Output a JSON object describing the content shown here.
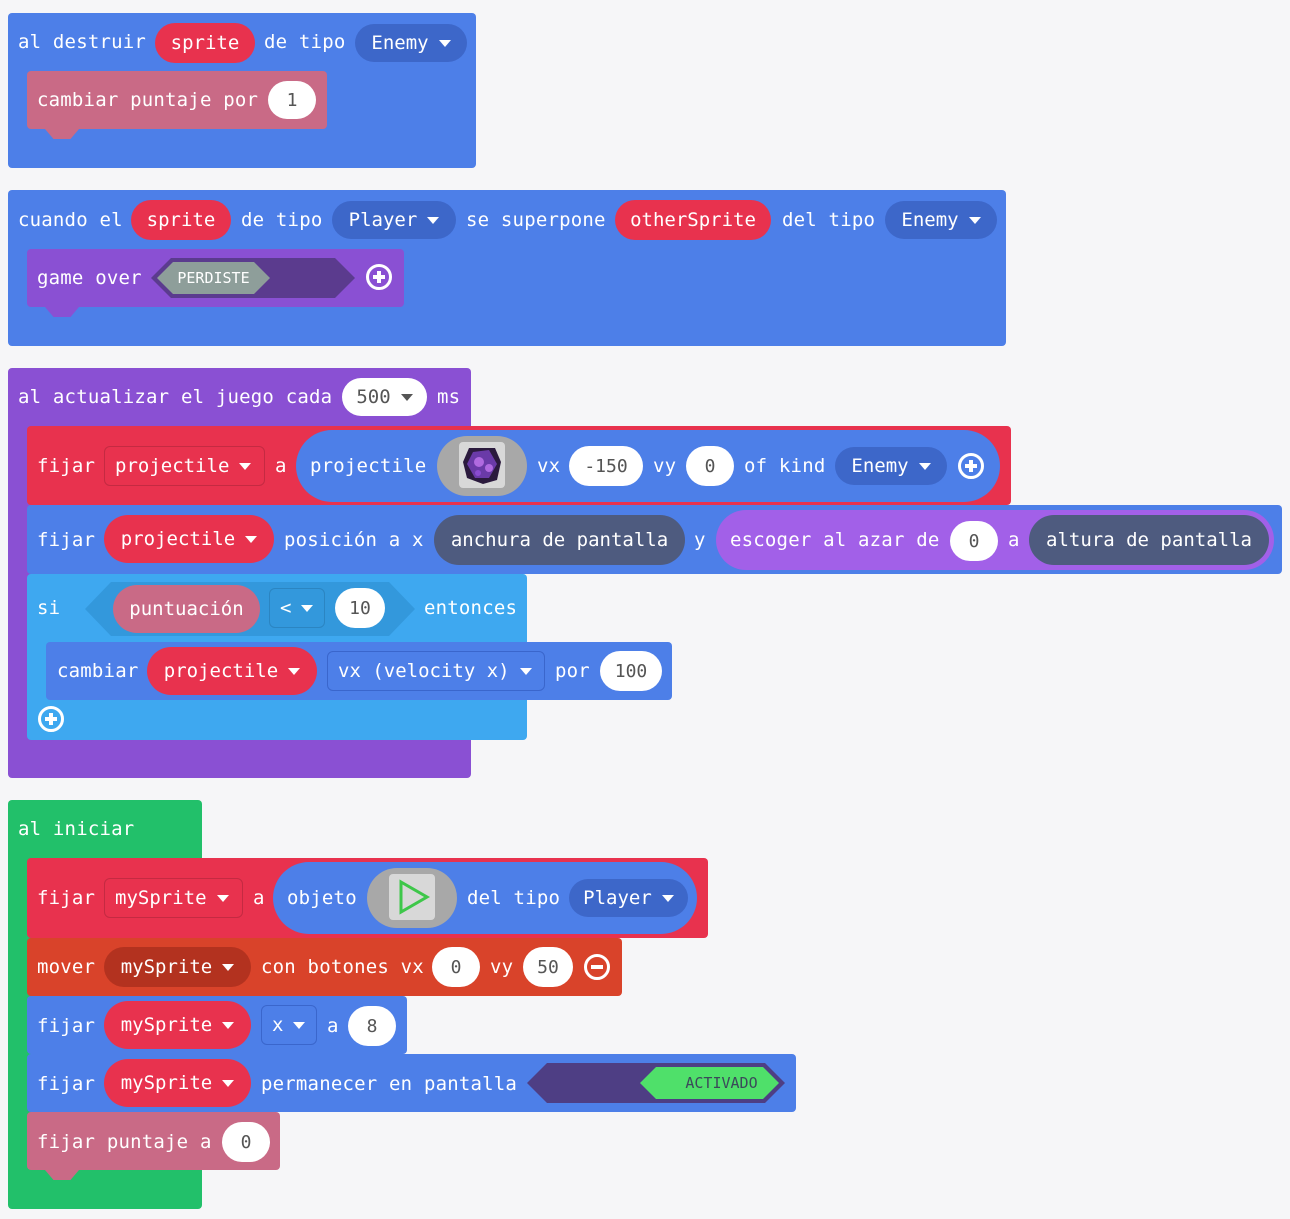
{
  "colors": {
    "sprites_blue": "#4d7fe8",
    "info_pink": "#c96a86",
    "game_purple": "#8a50d3",
    "logic_blue": "#3ea8f0",
    "loops_green": "#22c06a",
    "variables_red": "#e8324e",
    "controller_orange": "#d9432a",
    "images_dark": "#4e5b7f"
  },
  "block1": {
    "head": "al destruir",
    "sprite": "sprite",
    "of_type": "de tipo",
    "kind": "Enemy",
    "change_score": "cambiar puntaje por",
    "change_value": "1"
  },
  "block2": {
    "head": "cuando el",
    "sprite": "sprite",
    "of_type": "de tipo",
    "kind": "Player",
    "overlaps": "se superpone",
    "other": "otherSprite",
    "of_kind": "del tipo",
    "other_kind": "Enemy",
    "game_over": "game over",
    "message": "PERDISTE"
  },
  "block3": {
    "head": "al actualizar el juego cada",
    "interval": "500",
    "unit": "ms",
    "set1": "fijar",
    "var1": "projectile",
    "to": "a",
    "projectile": "projectile",
    "vx": "vx",
    "vx_value": "-150",
    "vy": "vy",
    "vy_value": "0",
    "of_kind": "of kind",
    "kind": "Enemy",
    "set2": "fijar",
    "var2": "projectile",
    "position": "posición a x",
    "screen_width": "anchura de pantalla",
    "y": "y",
    "random": "escoger al azar de",
    "random_from": "0",
    "random_to_label": "a",
    "screen_height": "altura de pantalla",
    "if": "si",
    "score_var": "puntuación",
    "operator": "<",
    "compare_value": "10",
    "then": "entonces",
    "change": "cambiar",
    "var3": "projectile",
    "property": "vx (velocity x)",
    "by": "por",
    "by_value": "100"
  },
  "block4": {
    "head": "al iniciar",
    "set1": "fijar",
    "var1": "mySprite",
    "to": "a",
    "sprite_label": "objeto",
    "of_kind": "del tipo",
    "kind": "Player",
    "move": "mover",
    "move_var": "mySprite",
    "with_buttons": "con botones vx",
    "move_vx": "0",
    "vy": "vy",
    "move_vy": "50",
    "set2": "fijar",
    "var2": "mySprite",
    "prop": "x",
    "to2": "a",
    "x_value": "8",
    "set3": "fijar",
    "var3": "mySprite",
    "stay": "permanecer en pantalla",
    "toggle": "ACTIVADO",
    "set_score": "fijar puntaje a",
    "score_value": "0"
  }
}
